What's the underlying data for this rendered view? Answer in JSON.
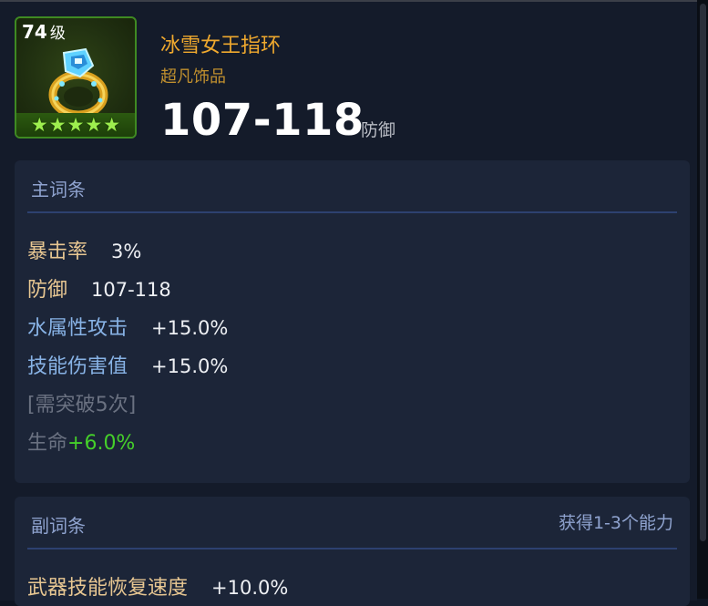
{
  "item": {
    "level_num": "74",
    "level_unit": "级",
    "name": "冰雪女王指环",
    "type": "超凡饰品",
    "stat_value": "107-118",
    "stat_unit": "防御",
    "stars": 5,
    "icon": "ice-ring-icon"
  },
  "main_attrs": {
    "title": "主词条",
    "rows": [
      {
        "label": "暴击率",
        "value": "3%"
      },
      {
        "label": "防御",
        "value": "107-118"
      },
      {
        "label": "水属性攻击",
        "value": "+15.0%"
      },
      {
        "label": "技能伤害值",
        "value": "+15.0%"
      }
    ],
    "locked_note": "[需突破5次]",
    "locked_label": "生命",
    "locked_value": "+6.0%"
  },
  "sub_attrs": {
    "title": "副词条",
    "hint": "获得1-3个能力",
    "rows": [
      {
        "label": "武器技能恢复速度",
        "value": "+10.0%"
      }
    ]
  },
  "colors": {
    "background": "#141b2a",
    "panel": "#1c2538",
    "name_orange": "#f0a92e",
    "green": "#45d02a",
    "blue_label": "#88b3e6"
  }
}
